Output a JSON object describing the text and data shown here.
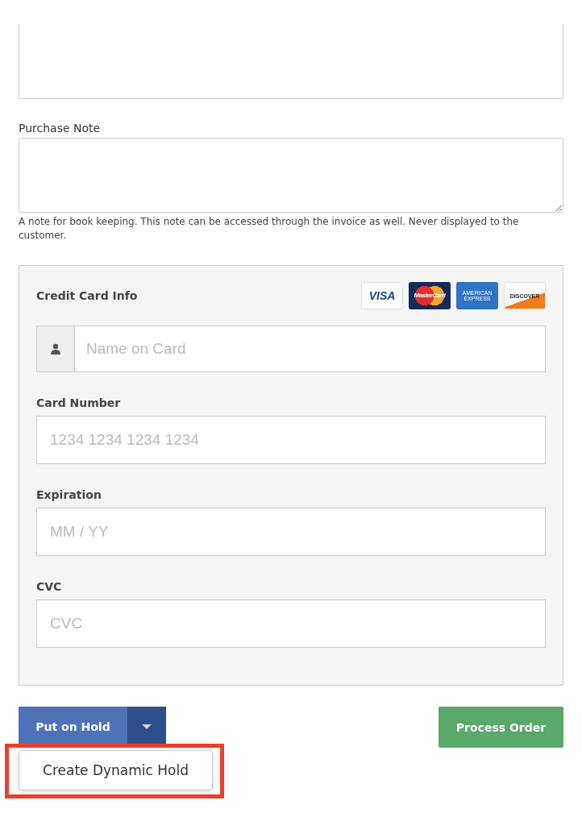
{
  "purchase_note": {
    "label": "Purchase Note",
    "help": "A note for book keeping. This note can be accessed through the invoice as well. Never displayed to the customer."
  },
  "credit_card": {
    "title": "Credit Card Info",
    "logos": [
      {
        "kind": "visa",
        "text": "VISA"
      },
      {
        "kind": "mastercard",
        "text": "MasterCard"
      },
      {
        "kind": "amex",
        "text": "AMERICAN EXPRESS"
      },
      {
        "kind": "discover",
        "text": "DISCOVER"
      }
    ],
    "fields": [
      {
        "kind": "icon",
        "placeholder": "Name on Card"
      },
      {
        "kind": "plain",
        "label": "Card Number",
        "placeholder": "1234 1234 1234 1234"
      },
      {
        "kind": "plain",
        "label": "Expiration",
        "placeholder": "MM / YY"
      },
      {
        "kind": "plain",
        "label": "CVC",
        "placeholder": "CVC"
      }
    ]
  },
  "actions": {
    "hold": "Put on Hold",
    "process": "Process Order",
    "menu": {
      "open": true,
      "highlighted": true,
      "items": [
        "Create Dynamic Hold"
      ]
    }
  }
}
